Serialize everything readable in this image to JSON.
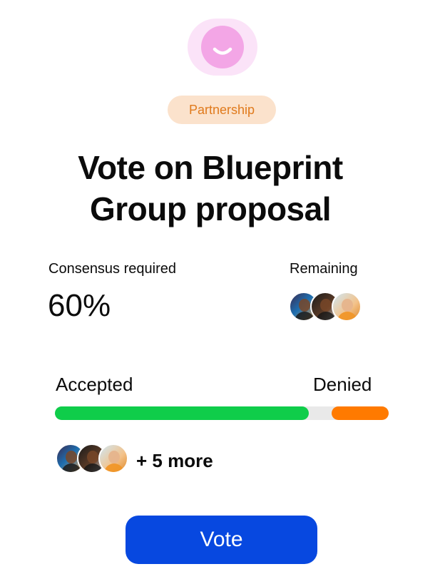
{
  "app": {
    "logo_icon": "smile-icon"
  },
  "tag": {
    "label": "Partnership",
    "color": "#e07a1c",
    "background": "#fbe2cc"
  },
  "title": {
    "prefix": "Vote on ",
    "bold_1": "Blueprint",
    "bold_2": "Group",
    "suffix": " proposal"
  },
  "stats": {
    "consensus_label": "Consensus required",
    "consensus_value": "60%",
    "remaining_label": "Remaining"
  },
  "vote_bar": {
    "accepted_label": "Accepted",
    "denied_label": "Denied",
    "accepted_fraction": 0.76,
    "denied_fraction": 0.17,
    "accepted_color": "#0fcd4a",
    "denied_color": "#ff7a00"
  },
  "voters": {
    "more_text": "+ 5 more"
  },
  "actions": {
    "vote_label": "Vote",
    "vote_color": "#0748e0"
  }
}
